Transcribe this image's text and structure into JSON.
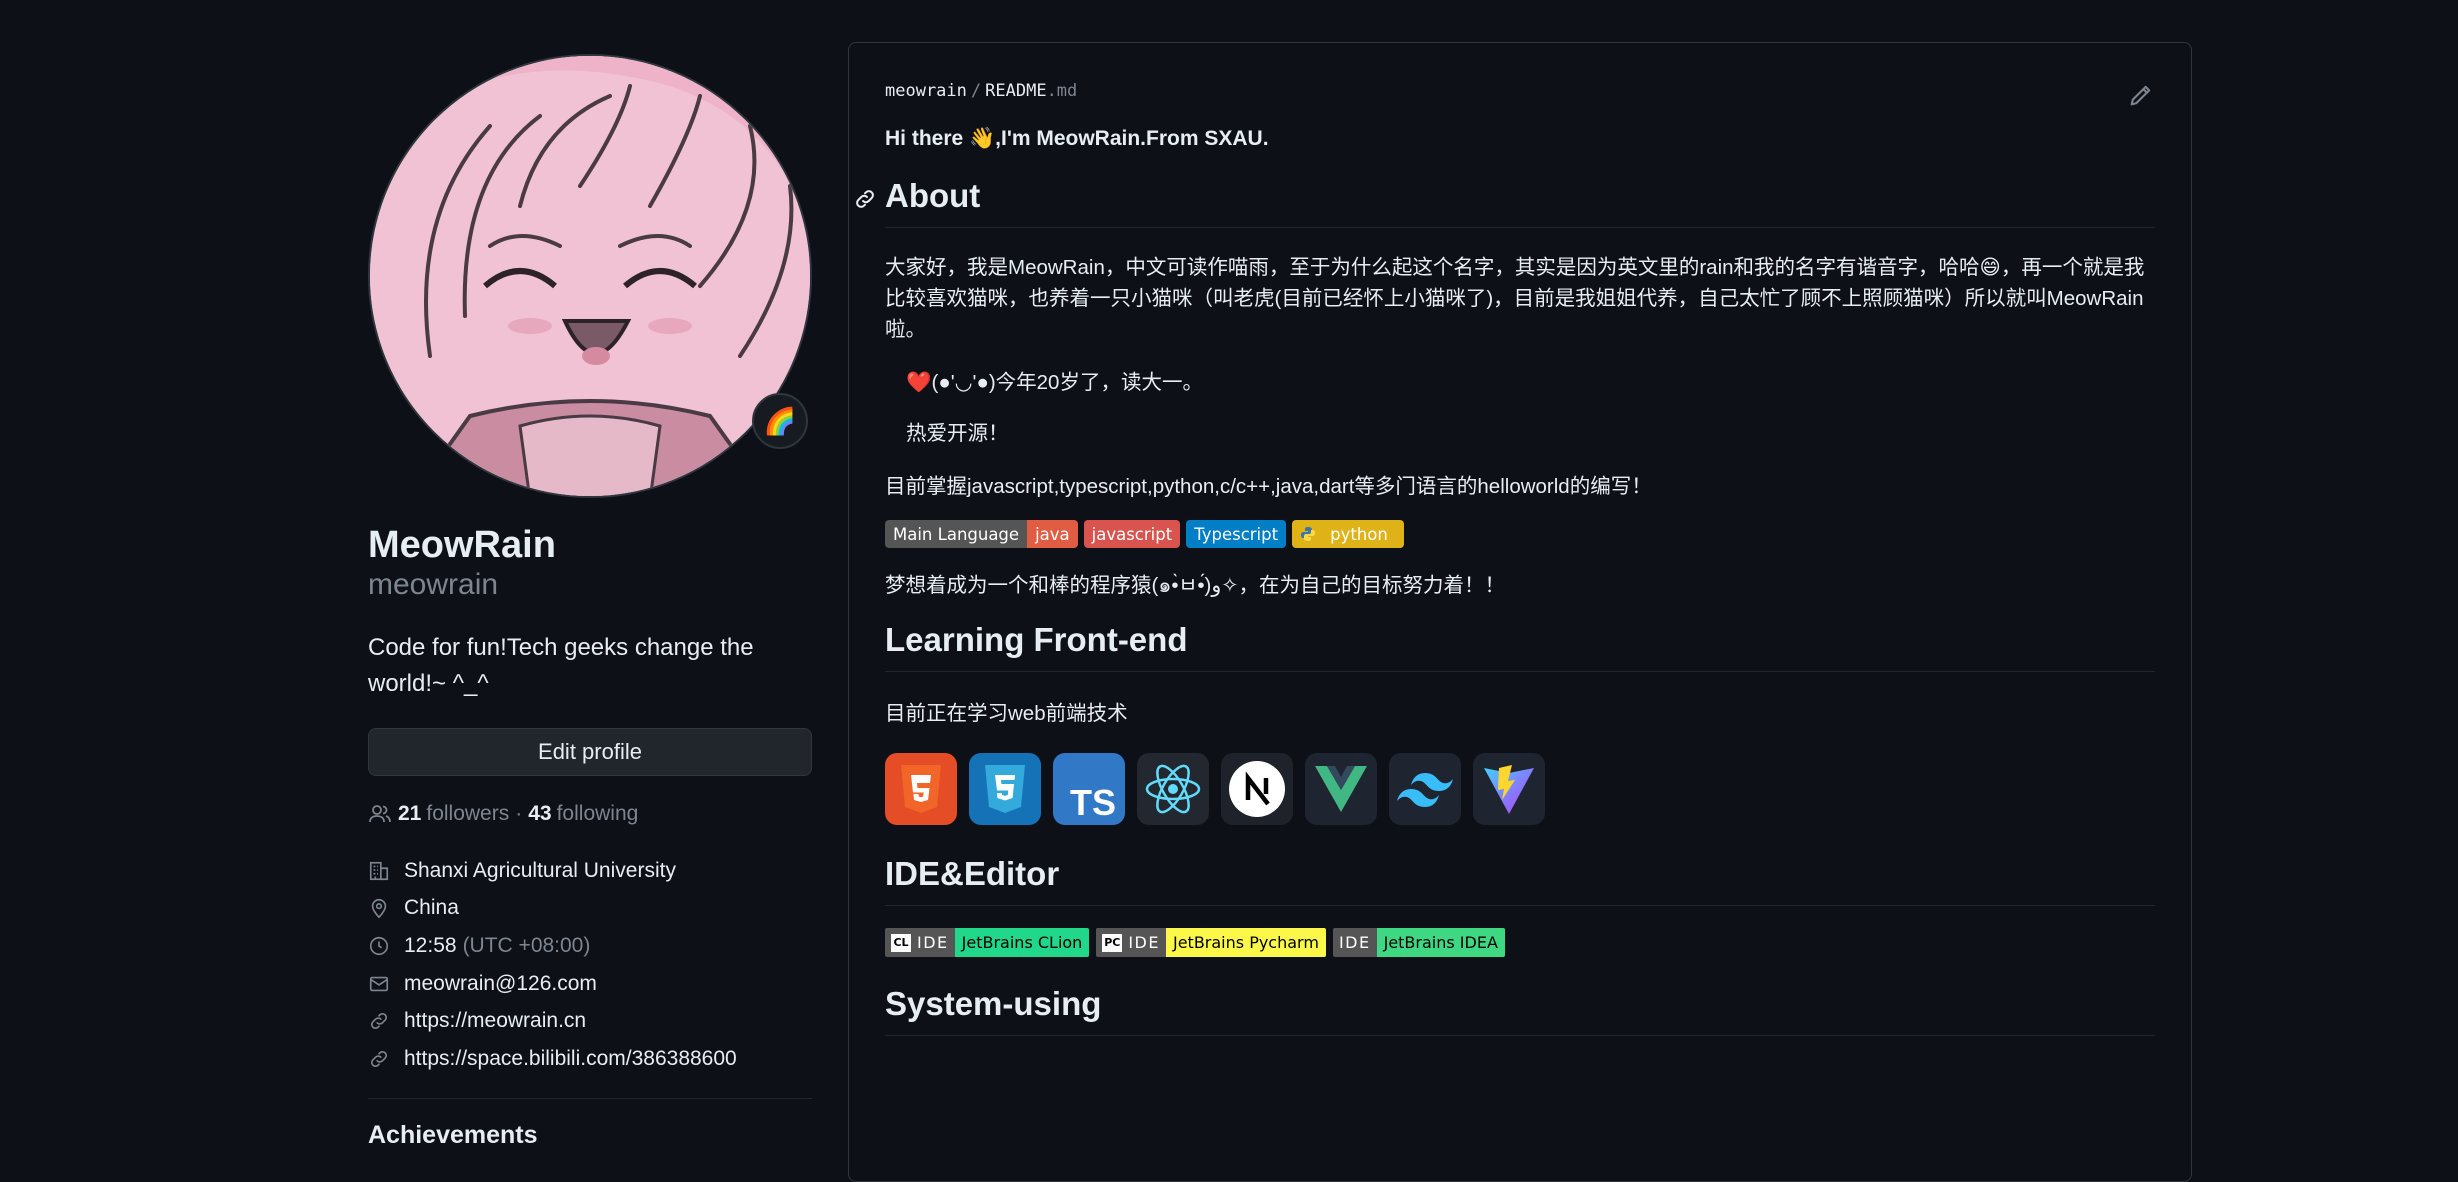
{
  "profile": {
    "name": "MeowRain",
    "login": "meowrain",
    "bio": "Code for fun!Tech geeks change the world!~ ^_^",
    "status_emoji": "🌈",
    "edit_label": "Edit profile",
    "followers_count": "21",
    "followers_label": "followers",
    "dot": "·",
    "following_count": "43",
    "following_label": "following",
    "organization": "Shanxi Agricultural University",
    "location": "China",
    "local_time": "12:58",
    "timezone": "(UTC +08:00)",
    "email": "meowrain@126.com",
    "website": "https://meowrain.cn",
    "social": "https://space.bilibili.com/386388600",
    "achievements_title": "Achievements"
  },
  "readme": {
    "crumb_user": "meowrain",
    "crumb_sep": "/",
    "crumb_file": "README",
    "crumb_ext": ".md",
    "greeting": "Hi there 👋,I'm MeowRain.From SXAU.",
    "about_title": "About",
    "about_p1": "大家好，我是MeowRain，中文可读作喵雨，至于为什么起这个名字，其实是因为英文里的rain和我的名字有谐音字，哈哈😄，再一个就是我比较喜欢猫咪，也养着一只小猫咪（叫老虎(目前已经怀上小猫咪了)，目前是我姐姐代养，自己太忙了顾不上照顾猫咪）所以就叫MeowRain啦。",
    "quote_1": "❤️(●'◡'●)今年20岁了，读大一。",
    "quote_2": "热爱开源！",
    "about_p2": "目前掌握javascript,typescript,python,c/c++,java,dart等多门语言的helloworld的编写！",
    "badges": {
      "main_label": "Main Language",
      "java": "java",
      "javascript": "javascript",
      "typescript": "Typescript",
      "python": "python",
      "colors": {
        "label": "#555555",
        "java": "#e05d44",
        "javascript": "#d9534f",
        "typescript": "#007ec6",
        "python": "#dfb317"
      }
    },
    "about_p3": "梦想着成为一个和棒的程序猿(๑•̀ㅂ•́)و✧，在为自己的目标努力着！！",
    "frontend_title": "Learning Front-end",
    "frontend_p": "目前正在学习web前端技术",
    "tech_icons": [
      "html5-icon",
      "css3-icon",
      "typescript-icon",
      "react-icon",
      "nextjs-icon",
      "vue-icon",
      "tailwind-icon",
      "vite-icon"
    ],
    "ide_title": "IDE&Editor",
    "ide_badges": [
      {
        "logo": "CL",
        "label": "IDE",
        "value": "JetBrains CLion",
        "color": "#21d789"
      },
      {
        "logo": "PC",
        "label": "IDE",
        "value": "JetBrains Pycharm",
        "color": "#fcf84a"
      },
      {
        "label": "IDE",
        "value": "JetBrains IDEA",
        "color": "#3fd882"
      }
    ],
    "system_title": "System-using"
  }
}
